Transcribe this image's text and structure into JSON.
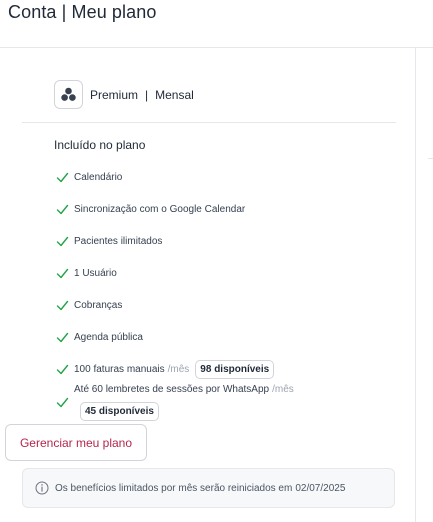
{
  "page": {
    "title": "Conta | Meu plano"
  },
  "plan": {
    "name": "Premium",
    "separator": "|",
    "period": "Mensal",
    "icon": "plan-nodes-icon"
  },
  "included": {
    "title": "Incluído no plano",
    "features": [
      {
        "label": "Calendário"
      },
      {
        "label": "Sincronização com o Google Calendar"
      },
      {
        "label": "Pacientes ilimitados"
      },
      {
        "label": "1 Usuário"
      },
      {
        "label": "Cobranças"
      },
      {
        "label": "Agenda pública"
      },
      {
        "label": "100 faturas manuais",
        "per": "/mês",
        "badge": "98 disponíveis"
      },
      {
        "label": "Até 60 lembretes de sessões por WhatsApp",
        "per": "/mês",
        "badge": "45 disponíveis"
      }
    ]
  },
  "actions": {
    "manage_label": "Gerenciar meu plano"
  },
  "notice": {
    "text_prefix": "Os benefícios limitados por mês serão reiniciados em",
    "date": "02/07/2025"
  },
  "colors": {
    "check": "#22a34a",
    "brand": "#b3264d",
    "icon": "#374151"
  }
}
